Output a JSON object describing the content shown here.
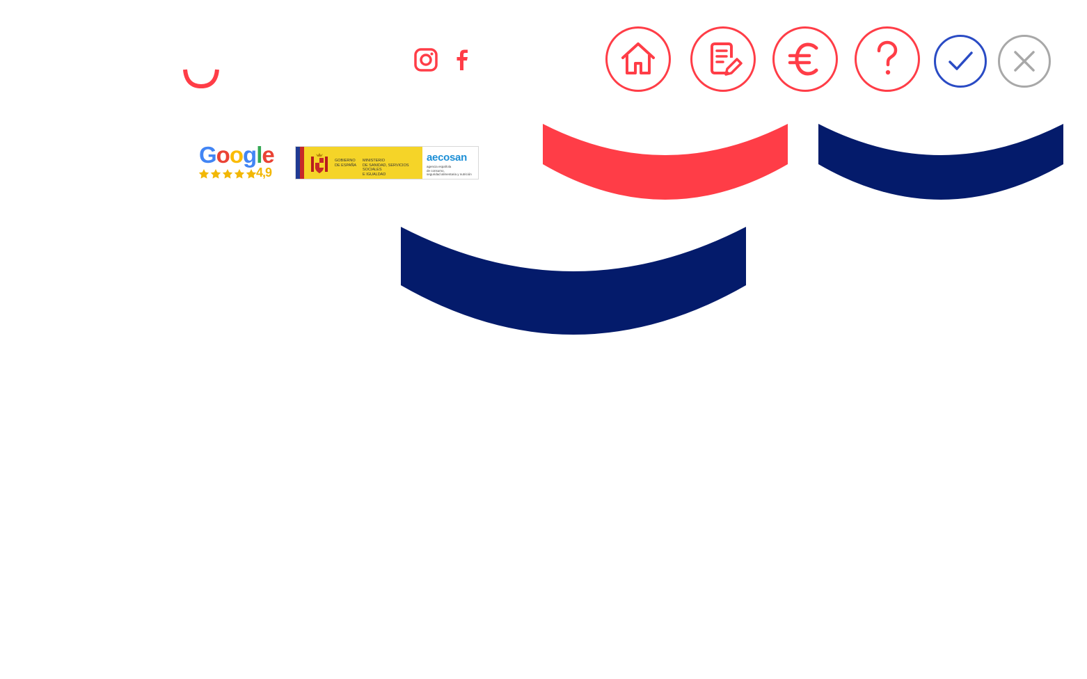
{
  "colors": {
    "brand_red": "#ff3d47",
    "navy": "#041b6b",
    "check_blue": "#2a4bc4",
    "close_gray": "#a8a8a8"
  },
  "header": {
    "social": [
      {
        "icon": "instagram-icon"
      },
      {
        "icon": "facebook-icon"
      }
    ],
    "nav_buttons": [
      {
        "icon": "home-icon"
      },
      {
        "icon": "document-edit-icon"
      },
      {
        "icon": "euro-icon"
      },
      {
        "icon": "question-mark-icon"
      }
    ],
    "accept_icon": "checkmark-icon",
    "close_icon": "close-icon"
  },
  "badges": {
    "google": {
      "wordmark": "Google",
      "rating": "4,9",
      "stars": 5
    },
    "government": {
      "line1": "GOBIERNO\nDE ESPAÑA",
      "line2": "MINISTERIO\nDE SANIDAD, SERVICIOS SOCIALES\nE IGUALDAD",
      "agency": "aecosan",
      "agency_sub": "agencia española\nde consumo,\nseguridad alimentaria y nutrición"
    }
  }
}
